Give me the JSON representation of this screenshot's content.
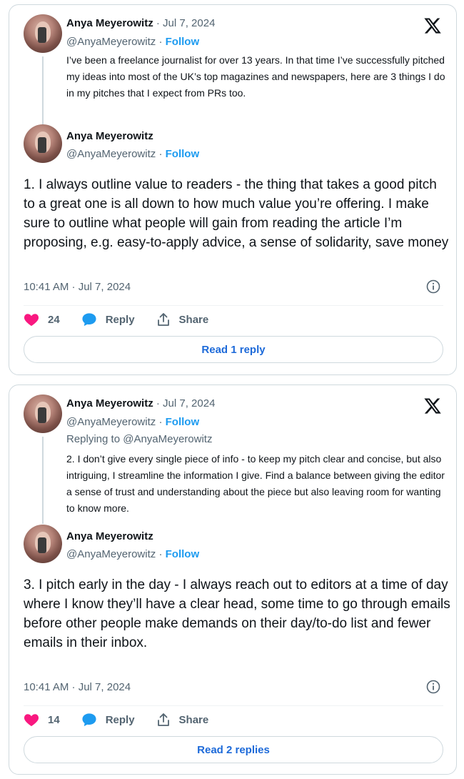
{
  "colors": {
    "accent": "#1d9bf0",
    "heart": "#f91880",
    "reply": "#1d9bf0",
    "border": "#cfd9de",
    "muted": "#536471"
  },
  "icons": {
    "logo": "x-logo-icon",
    "info": "info-icon",
    "like": "heart-icon",
    "reply": "speech-bubble-icon",
    "share": "share-icon"
  },
  "cards": [
    {
      "parent": {
        "name": "Anya Meyerowitz",
        "date": " · Jul 7, 2024",
        "handle": "@AnyaMeyerowitz",
        "dot": " · ",
        "follow": "Follow",
        "text": "I’ve been a freelance journalist for over 13 years. In that time I’ve successfully pitched my ideas into most of the UK’s top magazines and newspapers, here are 3 things I do in my pitches that I expect from PRs too."
      },
      "main": {
        "name": "Anya Meyerowitz",
        "handle": "@AnyaMeyerowitz",
        "dot": " · ",
        "follow": "Follow",
        "text": "1. I always outline value to readers - the thing that takes a good pitch to a great one is all down to how much value you’re offering. I make sure to outline what people will gain from reading the article I’m proposing, e.g. easy-to-apply advice, a sense of solidarity, save money",
        "timestamp": "10:41 AM · Jul 7, 2024",
        "likes": "24",
        "reply_label": "Reply",
        "share_label": "Share",
        "read_label": "Read 1 reply"
      }
    },
    {
      "parent": {
        "name": "Anya Meyerowitz",
        "date": " · Jul 7, 2024",
        "handle": "@AnyaMeyerowitz",
        "dot": " · ",
        "follow": "Follow",
        "replying_to": "Replying to @AnyaMeyerowitz",
        "text": "2. I don’t give every single piece of info - to keep my pitch clear and concise, but also intriguing, I streamline the information I give. Find a balance between giving the editor a sense of trust and understanding about the piece but also leaving room for wanting to know more."
      },
      "main": {
        "name": "Anya Meyerowitz",
        "handle": "@AnyaMeyerowitz",
        "dot": " · ",
        "follow": "Follow",
        "text": "3. I pitch early in the day - I always reach out to editors at a time of day where I know they’ll have a clear head, some time to go through emails before other people make demands on their day/to-do list and fewer emails in their inbox.",
        "timestamp": "10:41 AM · Jul 7, 2024",
        "likes": "14",
        "reply_label": "Reply",
        "share_label": "Share",
        "read_label": "Read 2 replies"
      }
    }
  ]
}
